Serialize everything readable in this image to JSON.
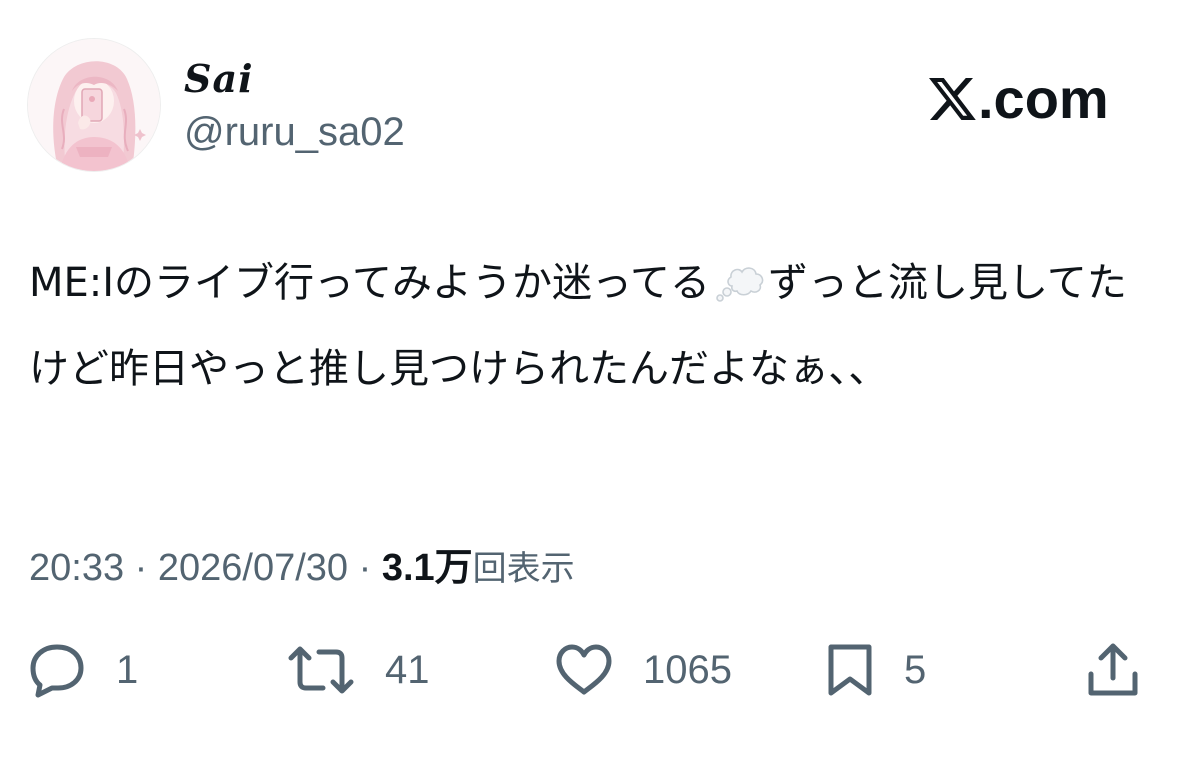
{
  "tweet": {
    "author": {
      "display_name": "Sai",
      "handle": "@ruru_sa02",
      "avatar_icon": "avatar-illustration-icon"
    },
    "brand": {
      "logo_icon": "x-logo-icon",
      "text": ".com"
    },
    "text_before_emoji": "ME:Iのライブ行ってみようか迷ってる",
    "emoji": "thought-balloon-icon",
    "text_after_emoji": "ずっと流し見してたけど昨日やっと推し見つけられたんだよなぁ、、",
    "meta": {
      "time": "20:33",
      "separator": "·",
      "date": "2026/07/30",
      "views_count": "3.1万",
      "views_label": "回表示"
    },
    "actions": {
      "reply_count": "1",
      "retweet_count": "41",
      "like_count": "1065",
      "bookmark_count": "5"
    }
  },
  "colors": {
    "text_primary": "#0f1419",
    "text_secondary": "#536471",
    "background": "#ffffff"
  }
}
